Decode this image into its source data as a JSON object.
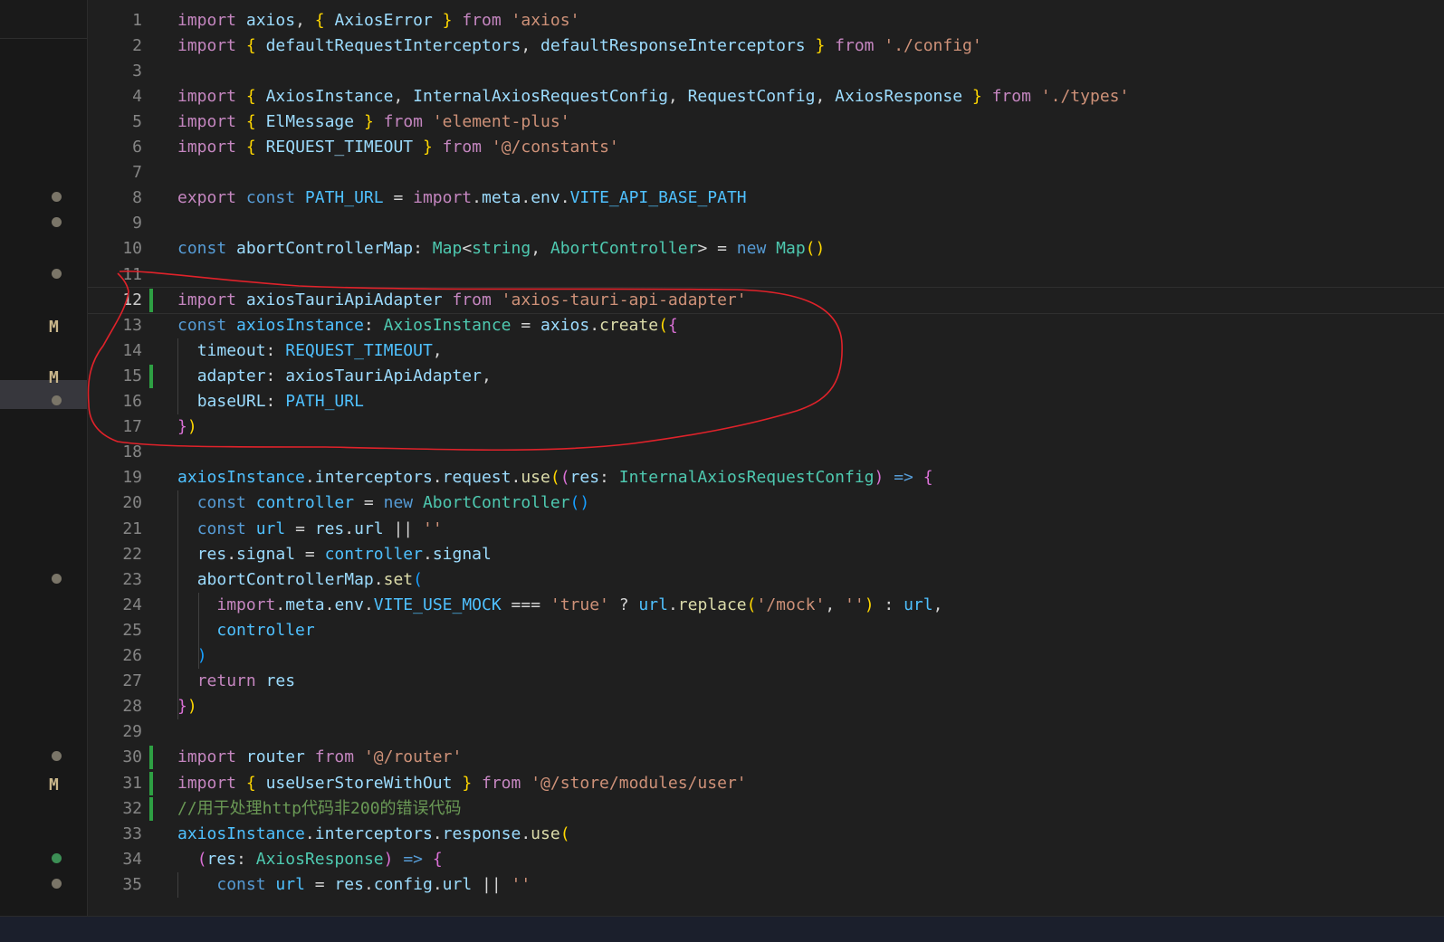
{
  "activity": {
    "markers": [
      {
        "type": "dot",
        "line": 8
      },
      {
        "type": "dot",
        "line": 9
      },
      {
        "type": "dot",
        "line": 11
      },
      {
        "type": "M",
        "line": 13
      },
      {
        "type": "M",
        "line": 15
      },
      {
        "type": "dot",
        "line": 16
      },
      {
        "type": "dot",
        "line": 23
      },
      {
        "type": "dot",
        "line": 30
      },
      {
        "type": "M",
        "line": 31
      },
      {
        "type": "dot-green",
        "line": 34
      },
      {
        "type": "dot",
        "line": 35
      }
    ]
  },
  "editor": {
    "active_line": 12,
    "modified_lines": [
      12,
      15,
      30,
      31,
      32
    ],
    "lines": [
      [
        [
          "kw",
          "import"
        ],
        [
          "pl",
          " "
        ],
        [
          "vr",
          "axios"
        ],
        [
          "pl",
          ", "
        ],
        [
          "b1",
          "{"
        ],
        [
          "pl",
          " "
        ],
        [
          "vr",
          "AxiosError"
        ],
        [
          "pl",
          " "
        ],
        [
          "b1",
          "}"
        ],
        [
          "pl",
          " "
        ],
        [
          "kw",
          "from"
        ],
        [
          "pl",
          " "
        ],
        [
          "st",
          "'axios'"
        ]
      ],
      [
        [
          "kw",
          "import"
        ],
        [
          "pl",
          " "
        ],
        [
          "b1",
          "{"
        ],
        [
          "pl",
          " "
        ],
        [
          "vr",
          "defaultRequestInterceptors"
        ],
        [
          "pl",
          ", "
        ],
        [
          "vr",
          "defaultResponseInterceptors"
        ],
        [
          "pl",
          " "
        ],
        [
          "b1",
          "}"
        ],
        [
          "pl",
          " "
        ],
        [
          "kw",
          "from"
        ],
        [
          "pl",
          " "
        ],
        [
          "st",
          "'./config'"
        ]
      ],
      [],
      [
        [
          "kw",
          "import"
        ],
        [
          "pl",
          " "
        ],
        [
          "b1",
          "{"
        ],
        [
          "pl",
          " "
        ],
        [
          "vr",
          "AxiosInstance"
        ],
        [
          "pl",
          ", "
        ],
        [
          "vr",
          "InternalAxiosRequestConfig"
        ],
        [
          "pl",
          ", "
        ],
        [
          "vr",
          "RequestConfig"
        ],
        [
          "pl",
          ", "
        ],
        [
          "vr",
          "AxiosResponse"
        ],
        [
          "pl",
          " "
        ],
        [
          "b1",
          "}"
        ],
        [
          "pl",
          " "
        ],
        [
          "kw",
          "from"
        ],
        [
          "pl",
          " "
        ],
        [
          "st",
          "'./types'"
        ]
      ],
      [
        [
          "kw",
          "import"
        ],
        [
          "pl",
          " "
        ],
        [
          "b1",
          "{"
        ],
        [
          "pl",
          " "
        ],
        [
          "vr",
          "ElMessage"
        ],
        [
          "pl",
          " "
        ],
        [
          "b1",
          "}"
        ],
        [
          "pl",
          " "
        ],
        [
          "kw",
          "from"
        ],
        [
          "pl",
          " "
        ],
        [
          "st",
          "'element-plus'"
        ]
      ],
      [
        [
          "kw",
          "import"
        ],
        [
          "pl",
          " "
        ],
        [
          "b1",
          "{"
        ],
        [
          "pl",
          " "
        ],
        [
          "vr",
          "REQUEST_TIMEOUT"
        ],
        [
          "pl",
          " "
        ],
        [
          "b1",
          "}"
        ],
        [
          "pl",
          " "
        ],
        [
          "kw",
          "from"
        ],
        [
          "pl",
          " "
        ],
        [
          "st",
          "'@/constants'"
        ]
      ],
      [],
      [
        [
          "kw",
          "export"
        ],
        [
          "pl",
          " "
        ],
        [
          "sk",
          "const"
        ],
        [
          "pl",
          " "
        ],
        [
          "cn",
          "PATH_URL"
        ],
        [
          "pl",
          " = "
        ],
        [
          "kw",
          "import"
        ],
        [
          "pl",
          "."
        ],
        [
          "vr",
          "meta"
        ],
        [
          "pl",
          "."
        ],
        [
          "vr",
          "env"
        ],
        [
          "pl",
          "."
        ],
        [
          "cn",
          "VITE_API_BASE_PATH"
        ]
      ],
      [],
      [
        [
          "sk",
          "const"
        ],
        [
          "pl",
          " "
        ],
        [
          "vr",
          "abortControllerMap"
        ],
        [
          "pl",
          ": "
        ],
        [
          "ty",
          "Map"
        ],
        [
          "pl",
          "<"
        ],
        [
          "ty",
          "string"
        ],
        [
          "pl",
          ", "
        ],
        [
          "ty",
          "AbortController"
        ],
        [
          "pl",
          "> = "
        ],
        [
          "sk",
          "new"
        ],
        [
          "pl",
          " "
        ],
        [
          "ty",
          "Map"
        ],
        [
          "b1",
          "()"
        ]
      ],
      [],
      [
        [
          "kw",
          "import"
        ],
        [
          "pl",
          " "
        ],
        [
          "vr",
          "axiosTauriApiAdapter"
        ],
        [
          "pl",
          " "
        ],
        [
          "kw",
          "from"
        ],
        [
          "pl",
          " "
        ],
        [
          "st",
          "'axios-tauri-api-adapter'"
        ]
      ],
      [
        [
          "sk",
          "const"
        ],
        [
          "pl",
          " "
        ],
        [
          "cn",
          "axiosInstance"
        ],
        [
          "pl",
          ": "
        ],
        [
          "ty",
          "AxiosInstance"
        ],
        [
          "pl",
          " = "
        ],
        [
          "vr",
          "axios"
        ],
        [
          "pl",
          "."
        ],
        [
          "fn",
          "create"
        ],
        [
          "b1",
          "("
        ],
        [
          "b2",
          "{"
        ]
      ],
      [
        [
          "pl",
          "  "
        ],
        [
          "vr",
          "timeout"
        ],
        [
          "pl",
          ": "
        ],
        [
          "cn",
          "REQUEST_TIMEOUT"
        ],
        [
          "pl",
          ","
        ]
      ],
      [
        [
          "pl",
          "  "
        ],
        [
          "vr",
          "adapter"
        ],
        [
          "pl",
          ": "
        ],
        [
          "vr",
          "axiosTauriApiAdapter"
        ],
        [
          "pl",
          ","
        ]
      ],
      [
        [
          "pl",
          "  "
        ],
        [
          "vr",
          "baseURL"
        ],
        [
          "pl",
          ": "
        ],
        [
          "cn",
          "PATH_URL"
        ]
      ],
      [
        [
          "b2",
          "}"
        ],
        [
          "b1",
          ")"
        ]
      ],
      [],
      [
        [
          "cn",
          "axiosInstance"
        ],
        [
          "pl",
          "."
        ],
        [
          "vr",
          "interceptors"
        ],
        [
          "pl",
          "."
        ],
        [
          "vr",
          "request"
        ],
        [
          "pl",
          "."
        ],
        [
          "fn",
          "use"
        ],
        [
          "b1",
          "("
        ],
        [
          "b2",
          "("
        ],
        [
          "vr",
          "res"
        ],
        [
          "pl",
          ": "
        ],
        [
          "ty",
          "InternalAxiosRequestConfig"
        ],
        [
          "b2",
          ")"
        ],
        [
          "pl",
          " "
        ],
        [
          "sk",
          "=>"
        ],
        [
          "pl",
          " "
        ],
        [
          "b2",
          "{"
        ]
      ],
      [
        [
          "pl",
          "  "
        ],
        [
          "sk",
          "const"
        ],
        [
          "pl",
          " "
        ],
        [
          "cn",
          "controller"
        ],
        [
          "pl",
          " = "
        ],
        [
          "sk",
          "new"
        ],
        [
          "pl",
          " "
        ],
        [
          "ty",
          "AbortController"
        ],
        [
          "b3",
          "()"
        ]
      ],
      [
        [
          "pl",
          "  "
        ],
        [
          "sk",
          "const"
        ],
        [
          "pl",
          " "
        ],
        [
          "cn",
          "url"
        ],
        [
          "pl",
          " = "
        ],
        [
          "vr",
          "res"
        ],
        [
          "pl",
          "."
        ],
        [
          "vr",
          "url"
        ],
        [
          "pl",
          " || "
        ],
        [
          "st",
          "''"
        ]
      ],
      [
        [
          "pl",
          "  "
        ],
        [
          "vr",
          "res"
        ],
        [
          "pl",
          "."
        ],
        [
          "vr",
          "signal"
        ],
        [
          "pl",
          " = "
        ],
        [
          "cn",
          "controller"
        ],
        [
          "pl",
          "."
        ],
        [
          "vr",
          "signal"
        ]
      ],
      [
        [
          "pl",
          "  "
        ],
        [
          "vr",
          "abortControllerMap"
        ],
        [
          "pl",
          "."
        ],
        [
          "fn",
          "set"
        ],
        [
          "b3",
          "("
        ]
      ],
      [
        [
          "pl",
          "    "
        ],
        [
          "kw",
          "import"
        ],
        [
          "pl",
          "."
        ],
        [
          "vr",
          "meta"
        ],
        [
          "pl",
          "."
        ],
        [
          "vr",
          "env"
        ],
        [
          "pl",
          "."
        ],
        [
          "cn",
          "VITE_USE_MOCK"
        ],
        [
          "pl",
          " === "
        ],
        [
          "st",
          "'true'"
        ],
        [
          "pl",
          " ? "
        ],
        [
          "cn",
          "url"
        ],
        [
          "pl",
          "."
        ],
        [
          "fn",
          "replace"
        ],
        [
          "b1",
          "("
        ],
        [
          "st",
          "'/mock'"
        ],
        [
          "pl",
          ", "
        ],
        [
          "st",
          "''"
        ],
        [
          "b1",
          ")"
        ],
        [
          "pl",
          " : "
        ],
        [
          "cn",
          "url"
        ],
        [
          "pl",
          ","
        ]
      ],
      [
        [
          "pl",
          "    "
        ],
        [
          "cn",
          "controller"
        ]
      ],
      [
        [
          "pl",
          "  "
        ],
        [
          "b3",
          ")"
        ]
      ],
      [
        [
          "pl",
          "  "
        ],
        [
          "kw",
          "return"
        ],
        [
          "pl",
          " "
        ],
        [
          "vr",
          "res"
        ]
      ],
      [
        [
          "b2",
          "}"
        ],
        [
          "b1",
          ")"
        ]
      ],
      [],
      [
        [
          "kw",
          "import"
        ],
        [
          "pl",
          " "
        ],
        [
          "vr",
          "router"
        ],
        [
          "pl",
          " "
        ],
        [
          "kw",
          "from"
        ],
        [
          "pl",
          " "
        ],
        [
          "st",
          "'@/router'"
        ]
      ],
      [
        [
          "kw",
          "import"
        ],
        [
          "pl",
          " "
        ],
        [
          "b1",
          "{"
        ],
        [
          "pl",
          " "
        ],
        [
          "vr",
          "useUserStoreWithOut"
        ],
        [
          "pl",
          " "
        ],
        [
          "b1",
          "}"
        ],
        [
          "pl",
          " "
        ],
        [
          "kw",
          "from"
        ],
        [
          "pl",
          " "
        ],
        [
          "st",
          "'@/store/modules/user'"
        ]
      ],
      [
        [
          "cm",
          "//用于处理http代码非200的错误代码"
        ]
      ],
      [
        [
          "cn",
          "axiosInstance"
        ],
        [
          "pl",
          "."
        ],
        [
          "vr",
          "interceptors"
        ],
        [
          "pl",
          "."
        ],
        [
          "vr",
          "response"
        ],
        [
          "pl",
          "."
        ],
        [
          "fn",
          "use"
        ],
        [
          "b1",
          "("
        ]
      ],
      [
        [
          "pl",
          "  "
        ],
        [
          "b2",
          "("
        ],
        [
          "vr",
          "res"
        ],
        [
          "pl",
          ": "
        ],
        [
          "ty",
          "AxiosResponse"
        ],
        [
          "b2",
          ")"
        ],
        [
          "pl",
          " "
        ],
        [
          "sk",
          "=>"
        ],
        [
          "pl",
          " "
        ],
        [
          "b2",
          "{"
        ]
      ],
      [
        [
          "pl",
          "    "
        ],
        [
          "sk",
          "const"
        ],
        [
          "pl",
          " "
        ],
        [
          "cn",
          "url"
        ],
        [
          "pl",
          " = "
        ],
        [
          "vr",
          "res"
        ],
        [
          "pl",
          "."
        ],
        [
          "vr",
          "config"
        ],
        [
          "pl",
          "."
        ],
        [
          "vr",
          "url"
        ],
        [
          "pl",
          " || "
        ],
        [
          "st",
          "''"
        ]
      ]
    ]
  },
  "statusbar": {
    "text": ""
  }
}
